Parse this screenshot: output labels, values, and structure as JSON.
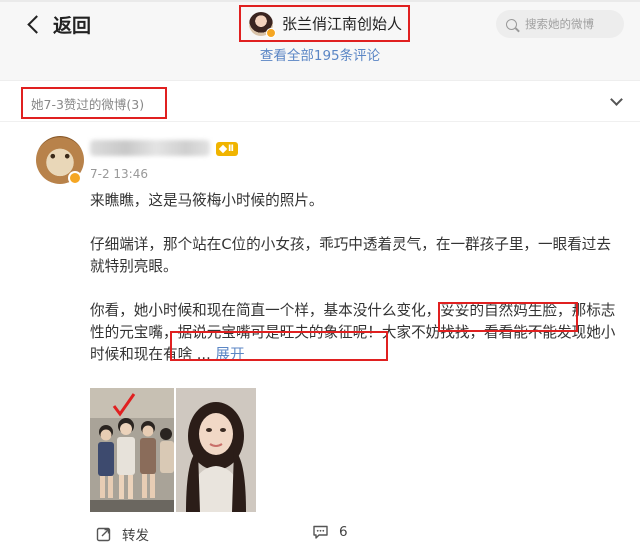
{
  "header": {
    "back_label": "返回",
    "profile_name": "张兰俏江南创始人",
    "search_placeholder": "搜索她的微博",
    "all_comments": "查看全部195条评论"
  },
  "filter": {
    "label": "她7-3赞过的微博(3)"
  },
  "post": {
    "level": "Ⅱ",
    "timestamp": "7-2 13:46",
    "para1": "来瞧瞧，这是马筱梅小时候的照片。",
    "para2_line1": "仔细端详，那个站在C位的小女孩，乖巧中透着灵气，在一群孩子里，一眼看过去",
    "para2_line2": "就特别亮眼。",
    "para3_line1": "你看，她小时候和现在简直一个样，基本没什么变化，妥妥的自然妈生脸，那标志",
    "para3_line2": "性的元宝嘴，据说元宝嘴可是旺夫的象征呢！大家不妨找找，看看能不能发现她小",
    "para3_line3_prefix": "时候和现在有啥  ... ",
    "expand_label": "展开"
  },
  "actions": {
    "repost_label": "转发",
    "comment_count": "6"
  },
  "colors": {
    "accent_blue": "#5b86c5",
    "highlight_red": "#e02020",
    "verified_orange": "#f5a623"
  }
}
